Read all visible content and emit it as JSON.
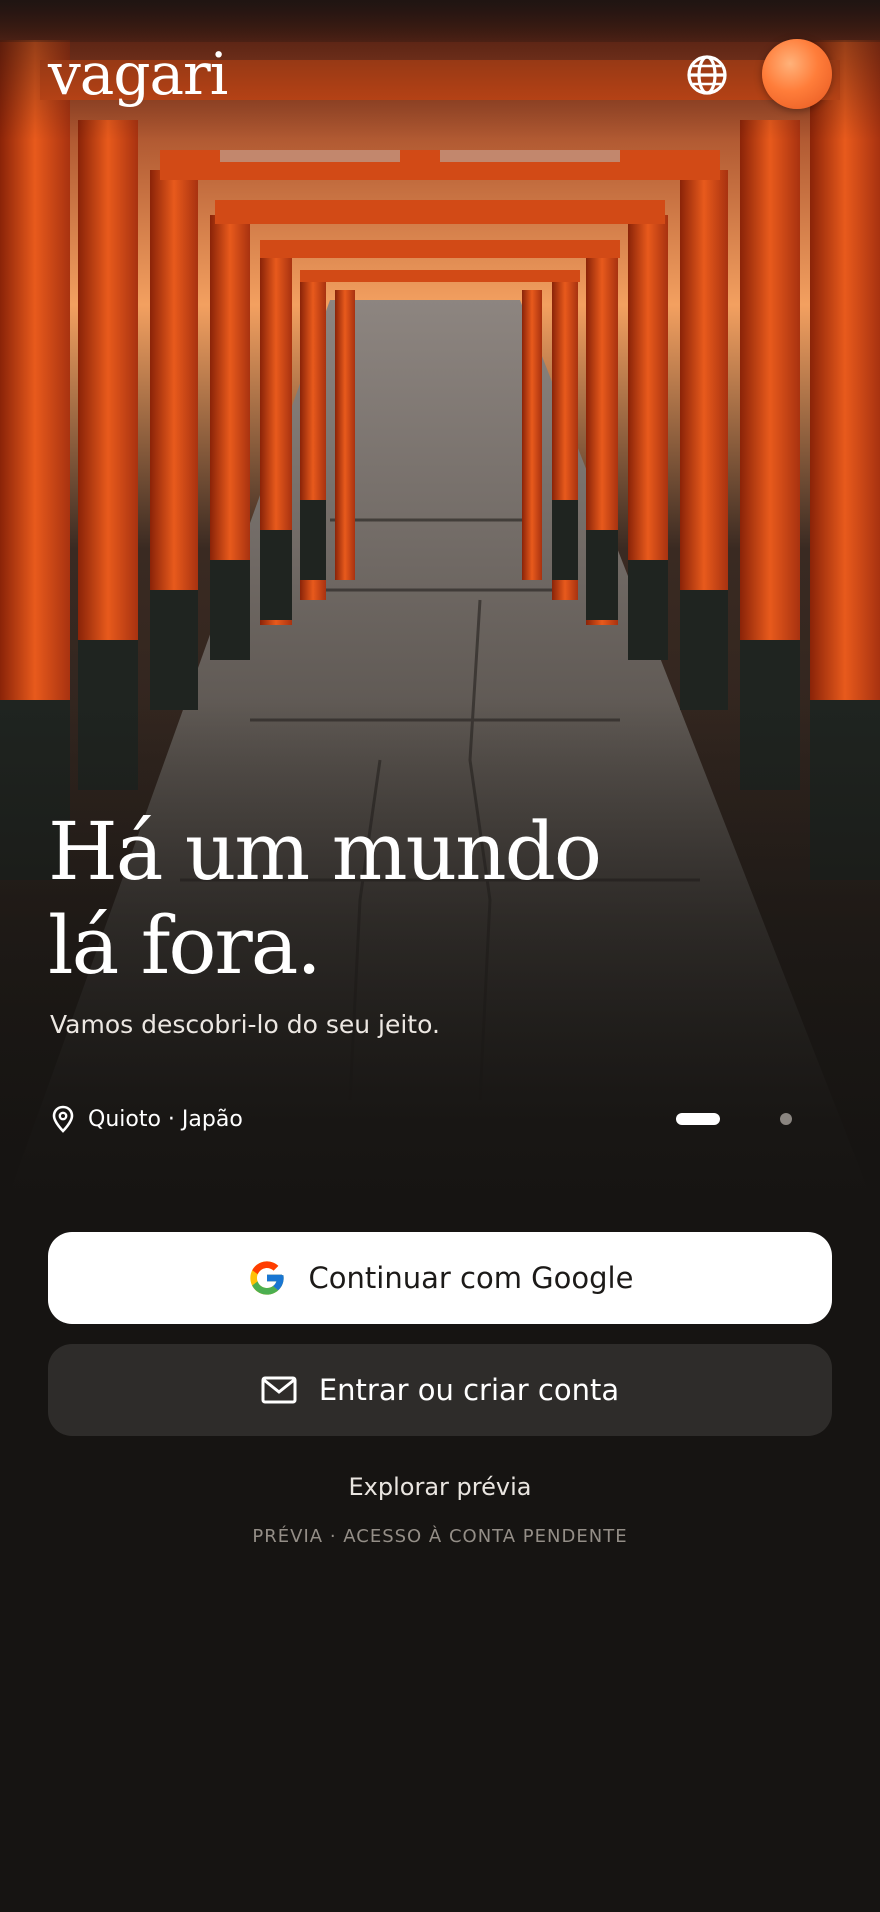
{
  "app": {
    "logo": "vagari"
  },
  "header": {
    "language_icon": "globe-icon",
    "profile_icon": "avatar"
  },
  "hero": {
    "headline_line1": "Há um mundo",
    "headline_line2": "lá fora.",
    "subtitle": "Vamos descobri-lo do seu jeito.",
    "location": "Quioto · Japão",
    "location_icon": "map-pin-icon",
    "carousel": {
      "slides": 2,
      "active": 1
    }
  },
  "actions": {
    "google_label": "Continuar com Google",
    "email_label": "Entrar ou criar conta",
    "explore_label": "Explorar prévia",
    "note": "PRÉVIA · ACESSO À CONTA PENDENTE"
  },
  "colors": {
    "background": "#161412",
    "accent": "#ff7d3a",
    "torii": "#e0501a"
  }
}
